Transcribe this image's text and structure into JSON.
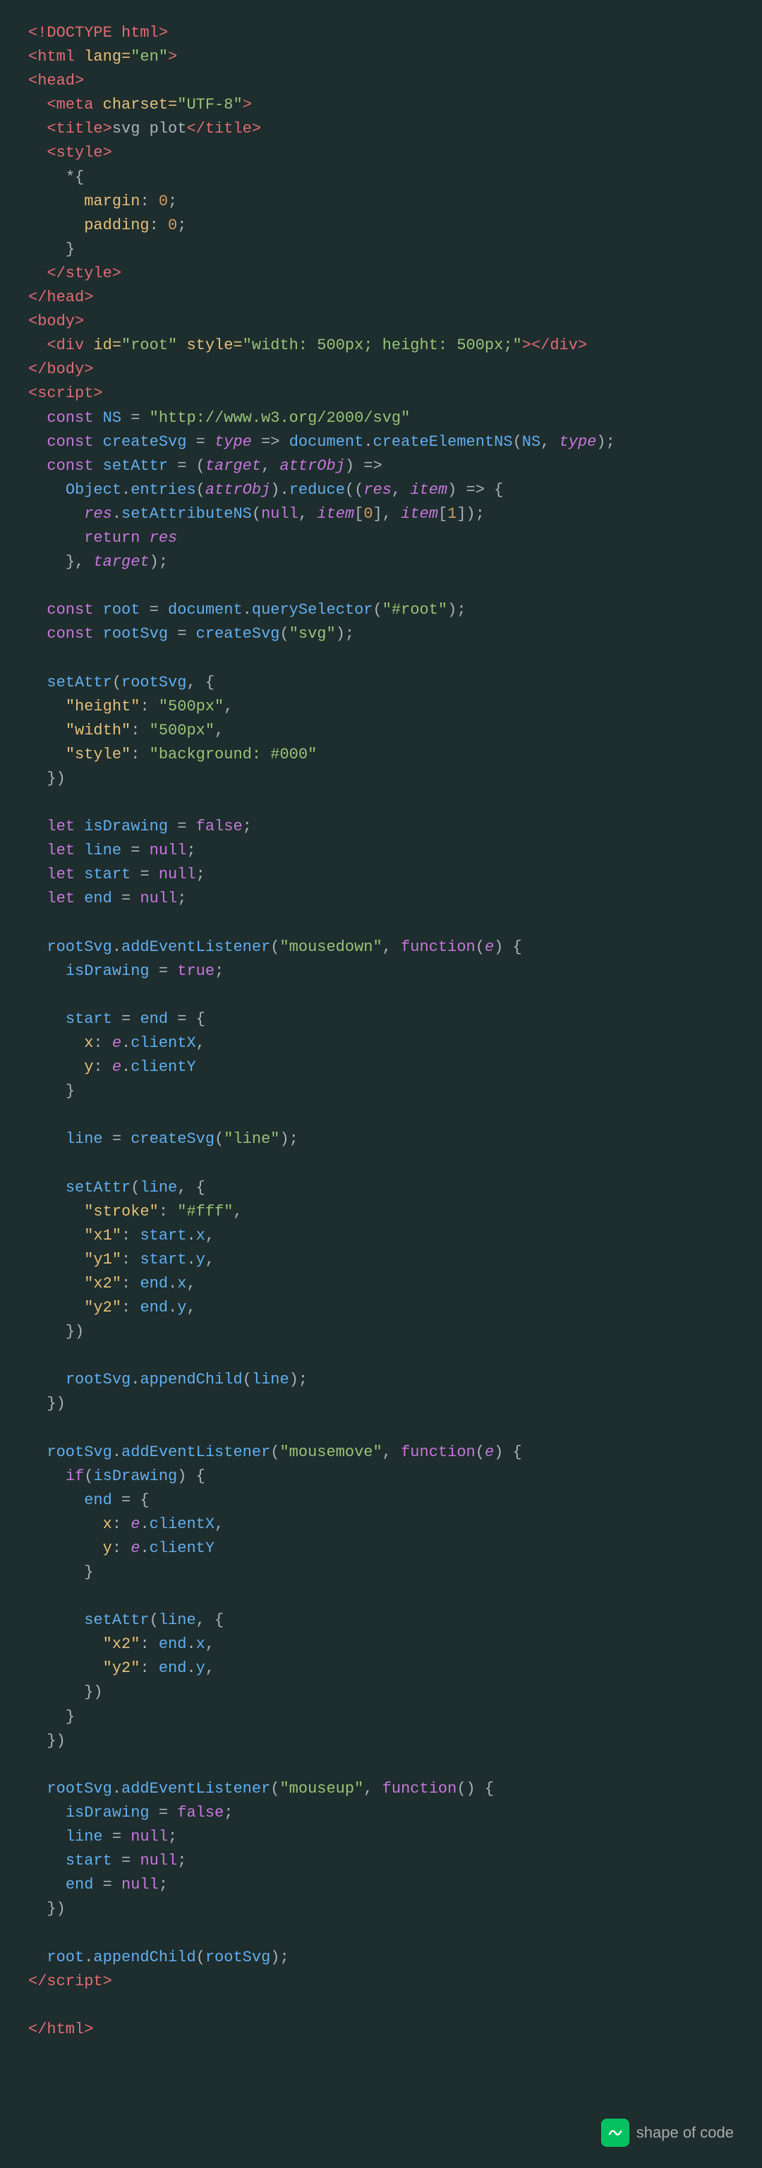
{
  "watermark": {
    "label": "shape of code"
  }
}
